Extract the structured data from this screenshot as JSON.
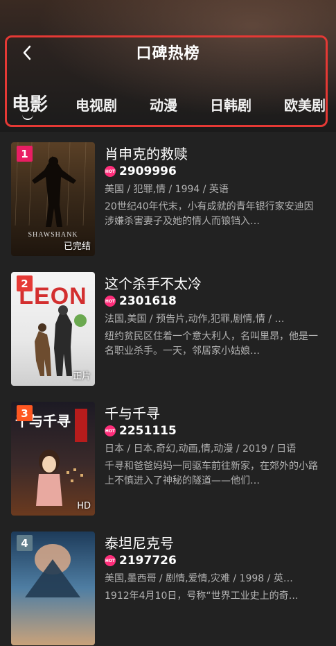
{
  "header": {
    "title": "口碑热榜",
    "tabs": [
      "电影",
      "电视剧",
      "动漫",
      "日韩剧",
      "欧美剧"
    ],
    "active_tab": 0
  },
  "colors": {
    "background": "#222222",
    "highlight_border": "#e53935",
    "hot": "#ff2d7a",
    "rank_1": "#e91e63",
    "rank_2": "#e53935",
    "rank_3": "#ff5722",
    "rank_4": "#607d8b"
  },
  "hot_icon_label": "HOT",
  "items": [
    {
      "rank": "1",
      "name": "肖申克的救赎",
      "hot": "2909996",
      "meta": "美国 / 犯罪,情 / 1994 / 英语",
      "desc": "20世纪40年代末，小有成就的青年银行家安迪因涉嫌杀害妻子及她的情人而锒铛入…",
      "tag": "已完结",
      "poster_text": "SHAWSHANK"
    },
    {
      "rank": "2",
      "name": "这个杀手不太冷",
      "hot": "2301618",
      "meta": "法国,美国 / 预告片,动作,犯罪,剧情,情 / …",
      "desc": "纽约贫民区住着一个意大利人，名叫里昂，他是一名职业杀手。一天，邻居家小姑娘…",
      "tag": "正片",
      "poster_text": "LEON"
    },
    {
      "rank": "3",
      "name": "千与千寻",
      "hot": "2251115",
      "meta": "日本 / 日本,奇幻,动画,情,动漫 / 2019 / 日语",
      "desc": "千寻和爸爸妈妈一同驱车前往新家，在郊外的小路上不慎进入了神秘的隧道——他们…",
      "tag": "HD",
      "poster_text": "千与千寻"
    },
    {
      "rank": "4",
      "name": "泰坦尼克号",
      "hot": "2197726",
      "meta": "美国,墨西哥 / 剧情,爱情,灾难 / 1998 / 英…",
      "desc": "1912年4月10日，号称“世界工业史上的奇…",
      "tag": "",
      "poster_text": ""
    }
  ]
}
